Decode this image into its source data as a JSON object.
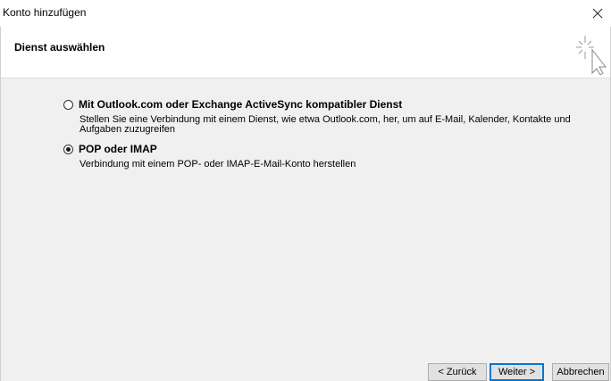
{
  "window": {
    "title": "Konto hinzufügen",
    "close_symbol": "×"
  },
  "header": {
    "title": "Dienst auswählen",
    "icon": "sparkle-cursor-icon"
  },
  "options": [
    {
      "label": "Mit Outlook.com oder Exchange ActiveSync kompatibler Dienst",
      "description": "Stellen Sie eine Verbindung mit einem Dienst, wie etwa Outlook.com, her, um auf E-Mail, Kalender, Kontakte und Aufgaben zuzugreifen",
      "selected": false
    },
    {
      "label": "POP oder IMAP",
      "description": "Verbindung mit einem POP- oder IMAP-E-Mail-Konto herstellen",
      "selected": true
    }
  ],
  "buttons": {
    "back": "< Zurück",
    "next": "Weiter >",
    "cancel": "Abbrechen"
  },
  "colors": {
    "content_bg": "#f0f0f0",
    "default_button_border": "#0078d7"
  }
}
